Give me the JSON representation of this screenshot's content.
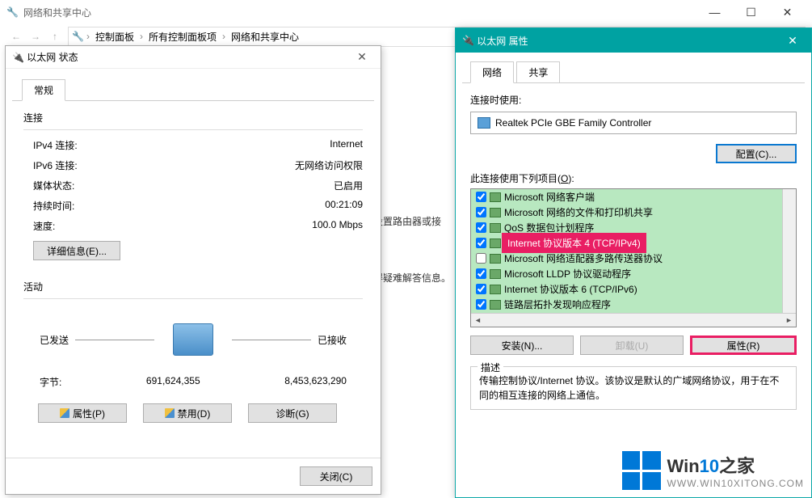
{
  "main": {
    "title": "网络和共享中心",
    "breadcrumb": [
      "控制面板",
      "所有控制面板项",
      "网络和共享中心"
    ],
    "body_hint1": "或设置路由器或接",
    "body_hint2": "获得疑难解答信息。"
  },
  "status": {
    "title": "以太网 状态",
    "tab_general": "常规",
    "section_conn": "连接",
    "rows": [
      {
        "k": "IPv4 连接:",
        "v": "Internet"
      },
      {
        "k": "IPv6 连接:",
        "v": "无网络访问权限"
      },
      {
        "k": "媒体状态:",
        "v": "已启用"
      },
      {
        "k": "持续时间:",
        "v": "00:21:09"
      },
      {
        "k": "速度:",
        "v": "100.0 Mbps"
      }
    ],
    "details_btn": "详细信息(E)...",
    "section_act": "活动",
    "sent": "已发送",
    "recv": "已接收",
    "bytes_label": "字节:",
    "bytes_sent": "691,624,355",
    "bytes_recv": "8,453,623,290",
    "btn_props": "属性(P)",
    "btn_disable": "禁用(D)",
    "btn_diag": "诊断(G)",
    "btn_close": "关闭(C)"
  },
  "props": {
    "title": "以太网 属性",
    "tab_net": "网络",
    "tab_share": "共享",
    "conn_using": "连接时使用:",
    "adapter": "Realtek PCIe GBE Family Controller",
    "btn_config": "配置(C)...",
    "items_label_pre": "此连接使用下列项目(",
    "items_label_u": "O",
    "items_label_post": "):",
    "items": [
      {
        "checked": true,
        "label": "Microsoft 网络客户端"
      },
      {
        "checked": true,
        "label": "Microsoft 网络的文件和打印机共享"
      },
      {
        "checked": true,
        "label": "QoS 数据包计划程序"
      },
      {
        "checked": true,
        "label": "Internet 协议版本 4 (TCP/IPv4)",
        "hl": true
      },
      {
        "checked": false,
        "label": "Microsoft 网络适配器多路传送器协议"
      },
      {
        "checked": true,
        "label": "Microsoft LLDP 协议驱动程序"
      },
      {
        "checked": true,
        "label": "Internet 协议版本 6 (TCP/IPv6)"
      },
      {
        "checked": true,
        "label": "链路层拓扑发现响应程序"
      }
    ],
    "btn_install": "安装(N)...",
    "btn_uninstall": "卸载(U)",
    "btn_props": "属性(R)",
    "desc_legend": "描述",
    "desc_text": "传输控制协议/Internet 协议。该协议是默认的广域网络协议，用于在不同的相互连接的网络上通信。"
  },
  "watermark": {
    "brand_a": "Win",
    "brand_b": "10",
    "brand_c": "之家",
    "url": "WWW.WIN10XITONG.COM"
  }
}
